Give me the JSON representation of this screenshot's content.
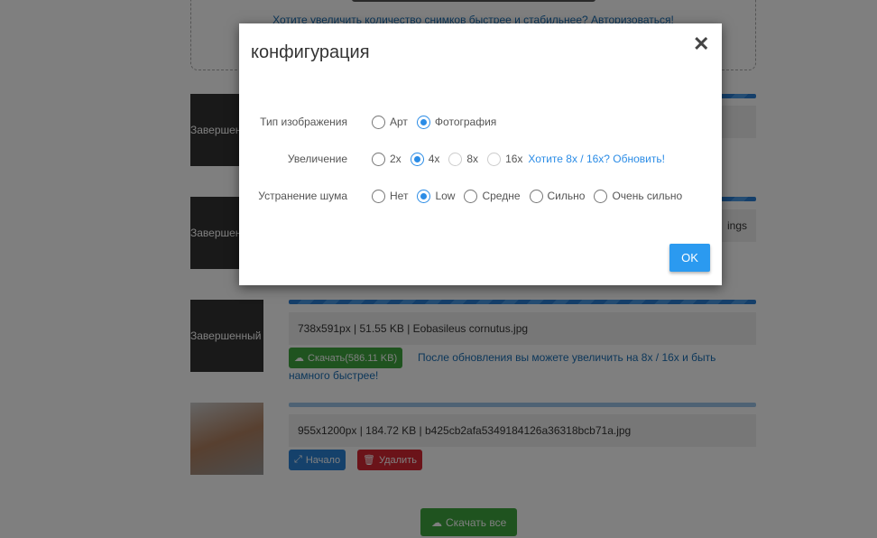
{
  "background": {
    "auth_link": "Хотите увеличить количество снимков быстрее и стабильнее? Авторизоваться!",
    "items": [
      {
        "status": "Завершенный",
        "info": "",
        "partial": ""
      },
      {
        "status": "Завершенный",
        "info": "",
        "partial": "ings"
      },
      {
        "status": "Завершенный",
        "info": "738x591px | 51.55 KB | Eobasileus cornutus.jpg",
        "download_label": "Скачать(586.11 KB)",
        "note": "После обновления вы можете увеличить на 8x / 16x и быть намного быстрее!"
      },
      {
        "status": "",
        "info": "955x1200px | 184.72 KB | b425cb2afa5349184126a36318bcb71a.jpg",
        "start_label": "Начало",
        "delete_label": "Удалить"
      }
    ],
    "download_all_label": "Скачать все"
  },
  "modal": {
    "title": "конфигурация",
    "close": "✕",
    "image_type": {
      "label": "Тип изображения",
      "options": [
        "Арт",
        "Фотография"
      ],
      "selected": "Фотография"
    },
    "scale": {
      "label": "Увеличение",
      "options": [
        "2x",
        "4x",
        "8x",
        "16x"
      ],
      "selected": "4x",
      "disabled": [
        "8x",
        "16x"
      ],
      "upgrade_link": "Хотите 8x / 16x? Обновить!"
    },
    "denoise": {
      "label": "Устранение шума",
      "options": [
        "Нет",
        "Low",
        "Средне",
        "Сильно",
        "Очень сильно"
      ],
      "selected": "Low"
    },
    "ok_label": "OK"
  },
  "colors": {
    "accent": "#2b9af0",
    "green": "#3ea63e",
    "red": "#d62632",
    "blue": "#2b82d6"
  }
}
